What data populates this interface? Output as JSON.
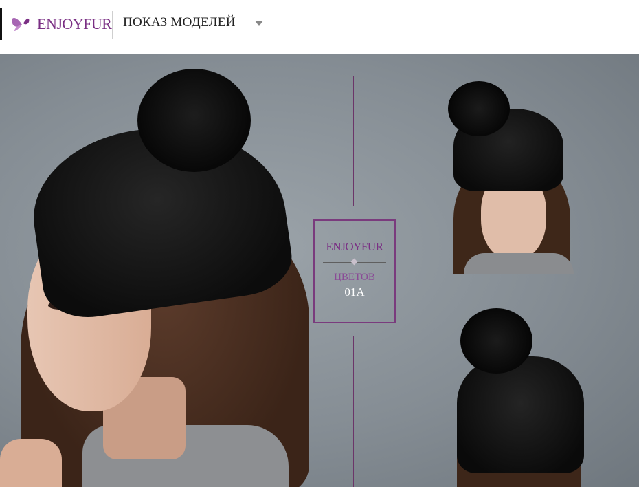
{
  "header": {
    "logo_text": "ENJOYFUR",
    "title": "ПОКАЗ МОДЕЛЕЙ",
    "dropdown_icon": "chevron-down-icon"
  },
  "photo_panel": {
    "badge_logo": "ENJOYFUR",
    "badge_label": "ЦВЕТОВ",
    "badge_value": "01A"
  },
  "colors": {
    "brand_purple": "#7a2f84",
    "background_gray": "#858d94"
  }
}
